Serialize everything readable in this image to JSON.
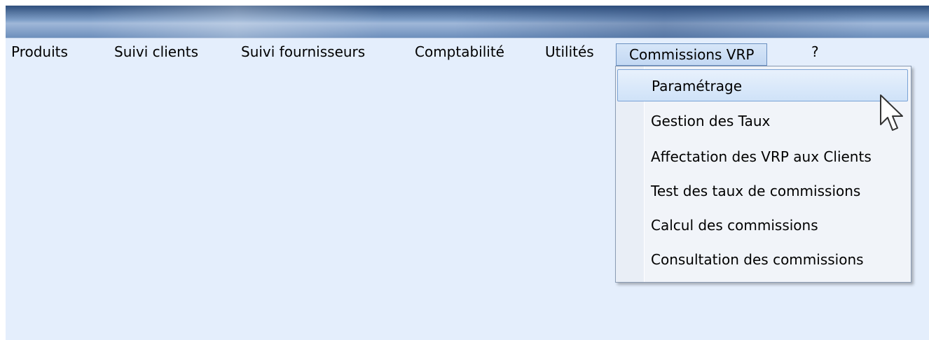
{
  "menubar": {
    "items": [
      {
        "label": "Produits"
      },
      {
        "label": "Suivi clients"
      },
      {
        "label": "Suivi fournisseurs"
      },
      {
        "label": "Comptabilité"
      },
      {
        "label": "Utilités"
      },
      {
        "label": "Commissions VRP"
      },
      {
        "label": "?"
      }
    ]
  },
  "dropdown": {
    "items": [
      {
        "label": "Paramétrage"
      },
      {
        "label": "Gestion des Taux"
      },
      {
        "label": "Affectation des VRP aux Clients"
      },
      {
        "label": "Test des taux de commissions"
      },
      {
        "label": "Calcul des commissions"
      },
      {
        "label": "Consultation des commissions"
      }
    ]
  },
  "icons": {
    "cursor": "mouse-pointer-icon"
  },
  "colors": {
    "background": "#e4eefc",
    "titlebar": "#6d8fbc",
    "menu_hover_border": "#7aa3d6",
    "menu_open_bg": "#c3d8f3"
  }
}
